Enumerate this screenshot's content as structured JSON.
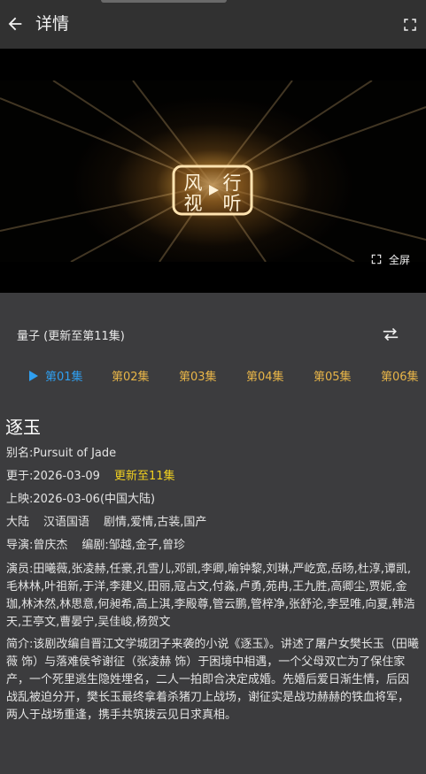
{
  "header": {
    "title": "详情",
    "back_icon": "arrow-left-icon",
    "expand_icon": "expand-icon"
  },
  "player": {
    "logo_icon": "fengxing-video-logo",
    "fullscreen_label": "全屏"
  },
  "source": {
    "label": "量子 (更新至第11集)",
    "switch_icon": "swap-arrows-icon"
  },
  "episodes": [
    "第01集",
    "第02集",
    "第03集",
    "第04集",
    "第05集",
    "第06集"
  ],
  "active_episode": "第01集",
  "drama": {
    "title": "逐玉",
    "alias_label": "别名:",
    "alias": "Pursuit of Jade",
    "updated_label": "更于:",
    "updated_date": "2026-03-09",
    "updated_status": "更新至11集",
    "release_label": "上映:",
    "release": "2026-03-06(中国大陆)",
    "region": "大陆",
    "language": "汉语国语",
    "genres": "剧情,爱情,古装,国产",
    "director_label": "导演:",
    "director": "曾庆杰",
    "writer_label": "编剧:",
    "writer": "邹越,金子,曾珍",
    "cast_label": "演员:",
    "cast": "田曦薇,张凌赫,任豪,孔雪儿,邓凯,李卿,喻钟黎,刘琳,严屹宽,岳旸,杜淳,谭凯,毛林林,叶祖新,于洋,李建义,田丽,寇占文,付淼,卢勇,苑冉,王九胜,高卿尘,贾妮,金珈,林沐然,林思意,何昶希,高上淇,李殿尊,管云鹏,管梓净,张舒沦,李昱唯,向夏,韩浩天,王亭文,曹晏宁,吴佳峻,杨贺文",
    "synopsis_label": "简介:",
    "synopsis": "该剧改编自晋江文学城团子来袭的小说《逐玉》。讲述了屠户女樊长玉（田曦薇 饰）与落难侯爷谢征（张凌赫 饰）于困境中相遇，一个父母双亡为了保住家产，一个死里逃生隐姓埋名，二人一拍即合决定成婚。先婚后爱日渐生情，后因战乱被迫分开，樊长玉最终拿着杀猪刀上战场，谢征实是战功赫赫的铁血将军，两人于战场重逢，携手共筑拨云见日求真相。"
  },
  "colors": {
    "background": "#3c3c3e",
    "topbar": "#313131",
    "episode": "#e8b548",
    "active_episode": "#2f9ff0",
    "update_highlight": "#f0d020"
  }
}
